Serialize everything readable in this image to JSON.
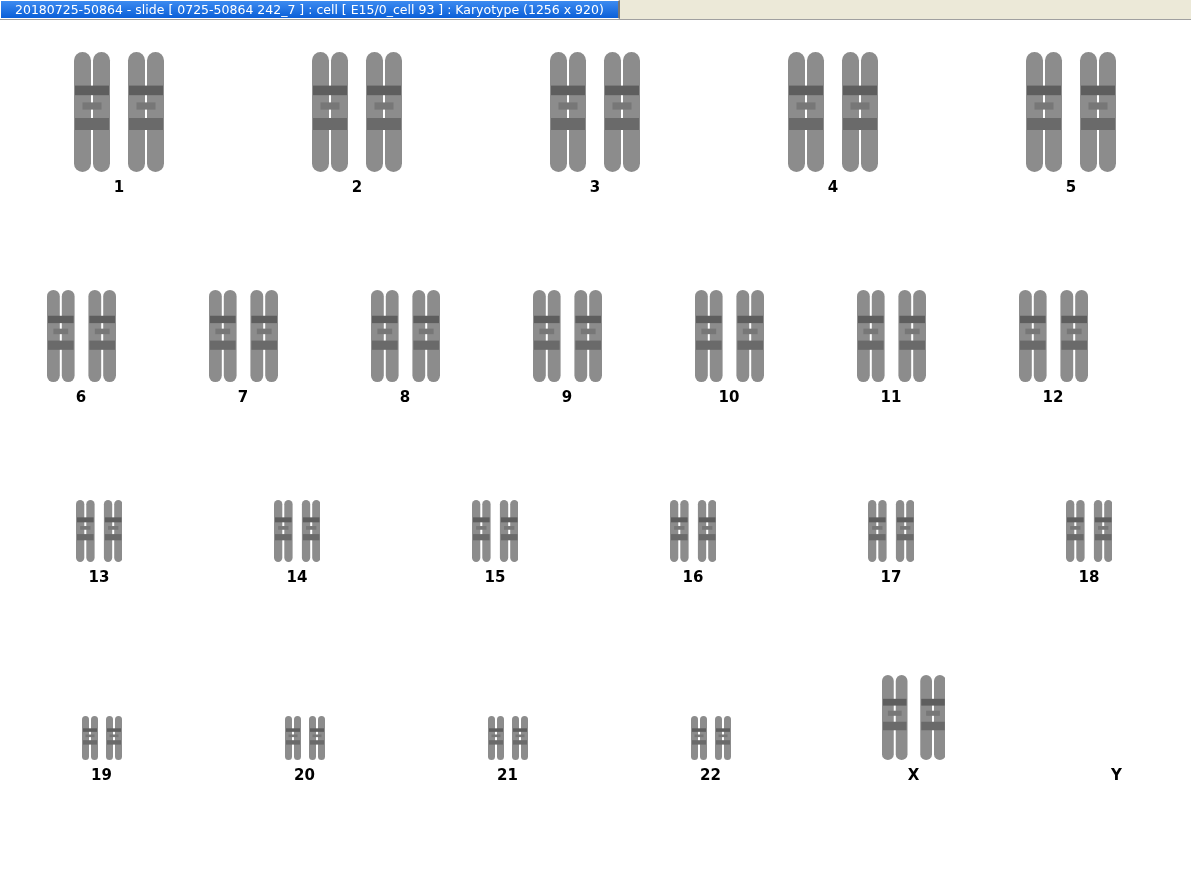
{
  "window": {
    "title": "20180725-50864 - slide [ 0725-50864 242_7 ] : cell [ E15/0_cell 93 ] : Karyotype  (1256 x 920)"
  },
  "karyogram_rows": [
    {
      "chromosomes": [
        {
          "label": "1",
          "kind": "pair"
        },
        {
          "label": "2",
          "kind": "pair"
        },
        {
          "label": "3",
          "kind": "pair"
        },
        {
          "label": "4",
          "kind": "pair"
        },
        {
          "label": "5",
          "kind": "pair"
        }
      ]
    },
    {
      "chromosomes": [
        {
          "label": "6",
          "kind": "pair"
        },
        {
          "label": "7",
          "kind": "pair"
        },
        {
          "label": "8",
          "kind": "pair"
        },
        {
          "label": "9",
          "kind": "pair"
        },
        {
          "label": "10",
          "kind": "pair"
        },
        {
          "label": "11",
          "kind": "pair"
        },
        {
          "label": "12",
          "kind": "pair"
        }
      ]
    },
    {
      "chromosomes": [
        {
          "label": "13",
          "kind": "pair"
        },
        {
          "label": "14",
          "kind": "pair"
        },
        {
          "label": "15",
          "kind": "pair"
        },
        {
          "label": "16",
          "kind": "pair"
        },
        {
          "label": "17",
          "kind": "pair"
        },
        {
          "label": "18",
          "kind": "pair"
        }
      ]
    },
    {
      "chromosomes": [
        {
          "label": "19",
          "kind": "pair"
        },
        {
          "label": "20",
          "kind": "pair"
        },
        {
          "label": "21",
          "kind": "pair"
        },
        {
          "label": "22",
          "kind": "pair"
        },
        {
          "label": "X",
          "kind": "large-pair"
        },
        {
          "label": "Y",
          "kind": "empty"
        }
      ]
    }
  ]
}
